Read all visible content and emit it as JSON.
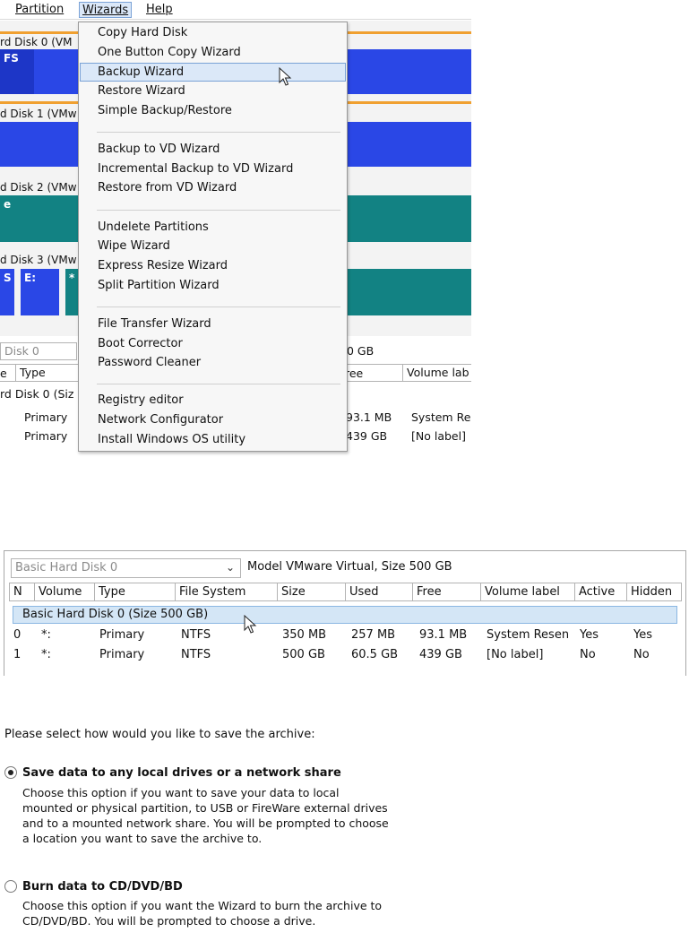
{
  "menubar": {
    "items": [
      "Partition",
      "Wizards",
      "Help"
    ],
    "active": "Wizards"
  },
  "disk_map": {
    "disk_labels": [
      "rd Disk 0 (VM",
      "d Disk 1 (VMw",
      "d Disk 2 (VMw",
      "d Disk 3 (VMw"
    ],
    "disk0_seg": "FS",
    "disk2_seg": "e",
    "disk3_segs": [
      "S",
      "E:",
      "*"
    ],
    "colors": {
      "blue": "#2a47e6",
      "teal": "#128283",
      "orange": "#f0a030"
    }
  },
  "lower_left": {
    "disk_combo": "Disk 0",
    "size_text": "0 GB",
    "col_e": "e",
    "col_type": "Type",
    "col_free": "ree",
    "col_volume": "Volume lab",
    "group_text": "rd Disk 0 (Siz",
    "rows": [
      {
        "type": "Primary",
        "free": "93.1 MB",
        "label": "System Re"
      },
      {
        "type": "Primary",
        "free": "439 GB",
        "label": "[No label]"
      }
    ]
  },
  "wizards_menu": {
    "items": [
      "Copy Hard Disk",
      "One Button Copy Wizard",
      "Backup Wizard",
      "Restore Wizard",
      "Simple Backup/Restore",
      "Backup to VD Wizard",
      "Incremental Backup to VD Wizard",
      "Restore from VD Wizard",
      "Undelete Partitions",
      "Wipe Wizard",
      "Express Resize Wizard",
      "Split Partition Wizard",
      "File Transfer Wizard",
      "Boot Corrector",
      "Password Cleaner",
      "Registry editor",
      "Network Configurator",
      "Install Windows OS utility"
    ],
    "highlighted": "Backup Wizard"
  },
  "disk_table": {
    "combo_value": "Basic Hard Disk 0",
    "model_text": "Model VMware Virtual, Size 500 GB",
    "columns": [
      "N",
      "Volume",
      "Type",
      "File System",
      "Size",
      "Used",
      "Free",
      "Volume label",
      "Active",
      "Hidden"
    ],
    "group": "Basic Hard Disk 0 (Size 500 GB)",
    "rows": [
      [
        "0",
        "*:",
        "Primary",
        "NTFS",
        "350 MB",
        "257 MB",
        "93.1 MB",
        "System Resen",
        "Yes",
        "Yes"
      ],
      [
        "1",
        "*:",
        "Primary",
        "NTFS",
        "500 GB",
        "60.5 GB",
        "439 GB",
        "[No label]",
        "No",
        "No"
      ]
    ]
  },
  "save_options": {
    "prompt": "Please select how would you like to save the archive:",
    "option1": {
      "title": "Save data to any local drives or a network share",
      "desc": "Choose this option if you want to save your data to local mounted or physical partition, to USB or FireWare external drives and to a mounted network share. You will be prompted to choose a location you want to save the archive to.",
      "selected": true
    },
    "option2": {
      "title": "Burn data to CD/DVD/BD",
      "desc": "Choose this option if you want the Wizard to burn the archive to CD/DVD/BD. You will be prompted to choose a drive.",
      "selected": false
    }
  }
}
